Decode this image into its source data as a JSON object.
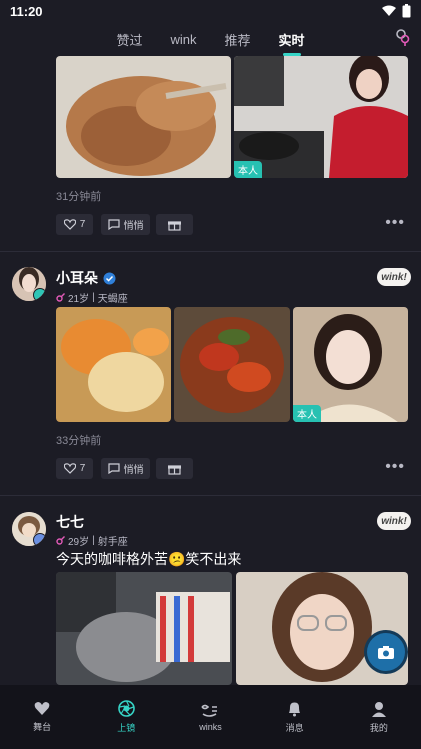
{
  "status": {
    "time": "11:20"
  },
  "tabs": [
    {
      "label": "赞过"
    },
    {
      "label": "wink"
    },
    {
      "label": "推荐"
    },
    {
      "label": "实时"
    }
  ],
  "posts": [
    {
      "time": "31分钟前",
      "like_count": "7",
      "chat_label": "悄悄",
      "badge": "本人"
    },
    {
      "name": "小耳朵",
      "age": "21岁",
      "sign": "天蝎座",
      "time": "33分钟前",
      "like_count": "7",
      "chat_label": "悄悄",
      "badge": "本人",
      "wink": "wink!"
    },
    {
      "name": "七七",
      "age": "29岁",
      "sign": "射手座",
      "text": "今天的咖啡格外苦😕笑不出来",
      "wink": "wink!"
    }
  ],
  "bottom_nav": [
    {
      "label": "舞台"
    },
    {
      "label": "上镜"
    },
    {
      "label": "winks"
    },
    {
      "label": "消息"
    },
    {
      "label": "我的"
    }
  ],
  "colors": {
    "accent": "#36d4c6",
    "bg": "#1c1c25",
    "badge": "#27c1b2"
  }
}
